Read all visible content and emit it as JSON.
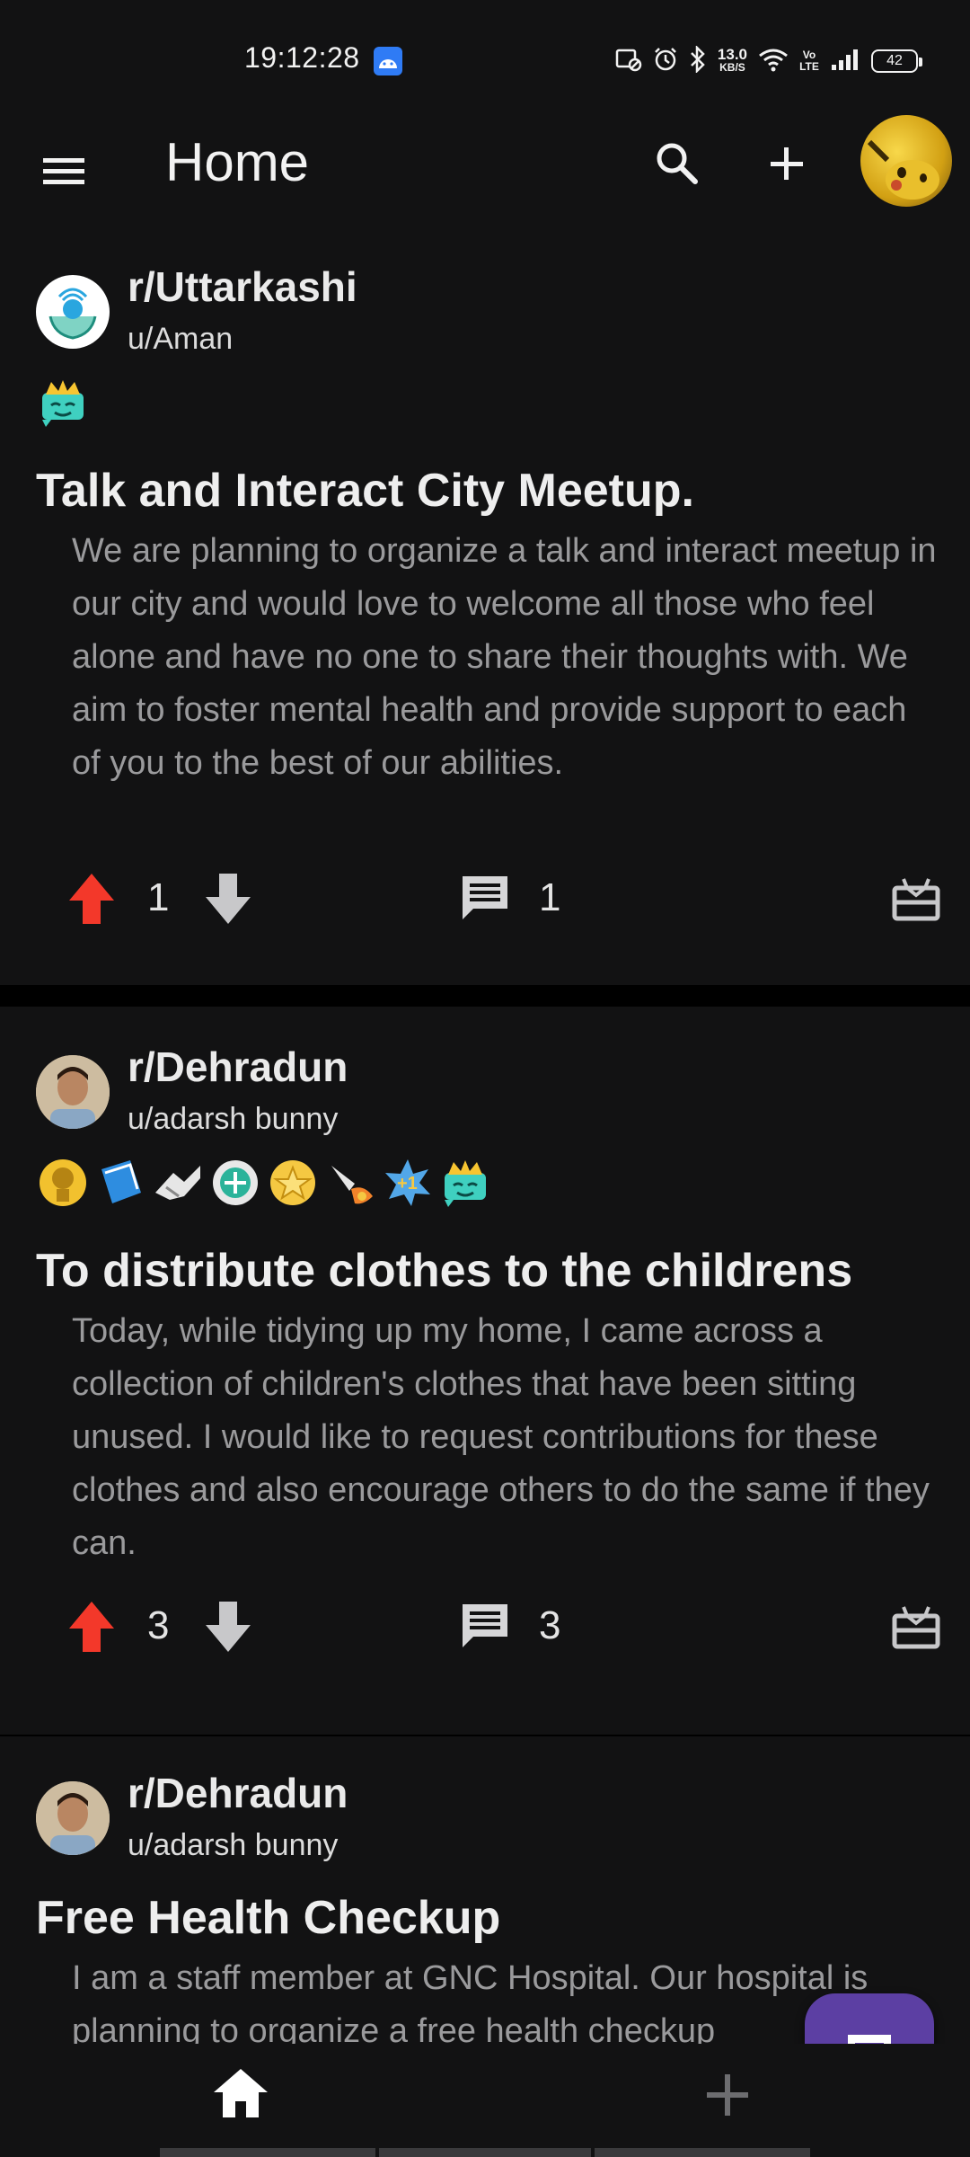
{
  "status_bar": {
    "time": "19:12:28",
    "net_speed_value": "13.0",
    "net_speed_unit": "KB/S",
    "volte_label": "Vo LTE",
    "battery": "42"
  },
  "app_bar": {
    "title": "Home"
  },
  "posts": [
    {
      "subreddit": "r/Uttarkashi",
      "user": "u/Aman",
      "title": "Talk and Interact City Meetup.",
      "body": "We are planning to organize a talk and interact meetup in our city and would love to welcome all those who feel alone and have no one to share their thoughts with. We aim to foster mental health and provide support to each of you to the best of our abilities.",
      "votes": "1",
      "comments": "1",
      "flairs": [
        "crown-robot-icon"
      ]
    },
    {
      "subreddit": "r/Dehradun",
      "user": "u/adarsh bunny",
      "title": "To distribute clothes to the childrens",
      "body": "Today, while tidying up my home, I came across a collection of children's clothes that have been sitting unused. I would like to request contributions for these clothes and also encourage others to do the same if they can.",
      "votes": "3",
      "comments": "3",
      "flairs": [
        "trophy-icon",
        "book-icon",
        "handshake-icon",
        "medal-icon",
        "star-badge-icon",
        "rocket-icon",
        "plus-one-icon",
        "crown-robot-icon"
      ]
    },
    {
      "subreddit": "r/Dehradun",
      "user": "u/adarsh bunny",
      "title": "Free Health Checkup",
      "body": "I am a staff member at GNC Hospital. Our hospital is planning to organize a free health checkup"
    }
  ],
  "colors": {
    "background": "#000000",
    "surface": "#121213",
    "upvote_active": "#f3382a",
    "fab": "#5c3fa3",
    "body_text": "#9a9a9c"
  }
}
